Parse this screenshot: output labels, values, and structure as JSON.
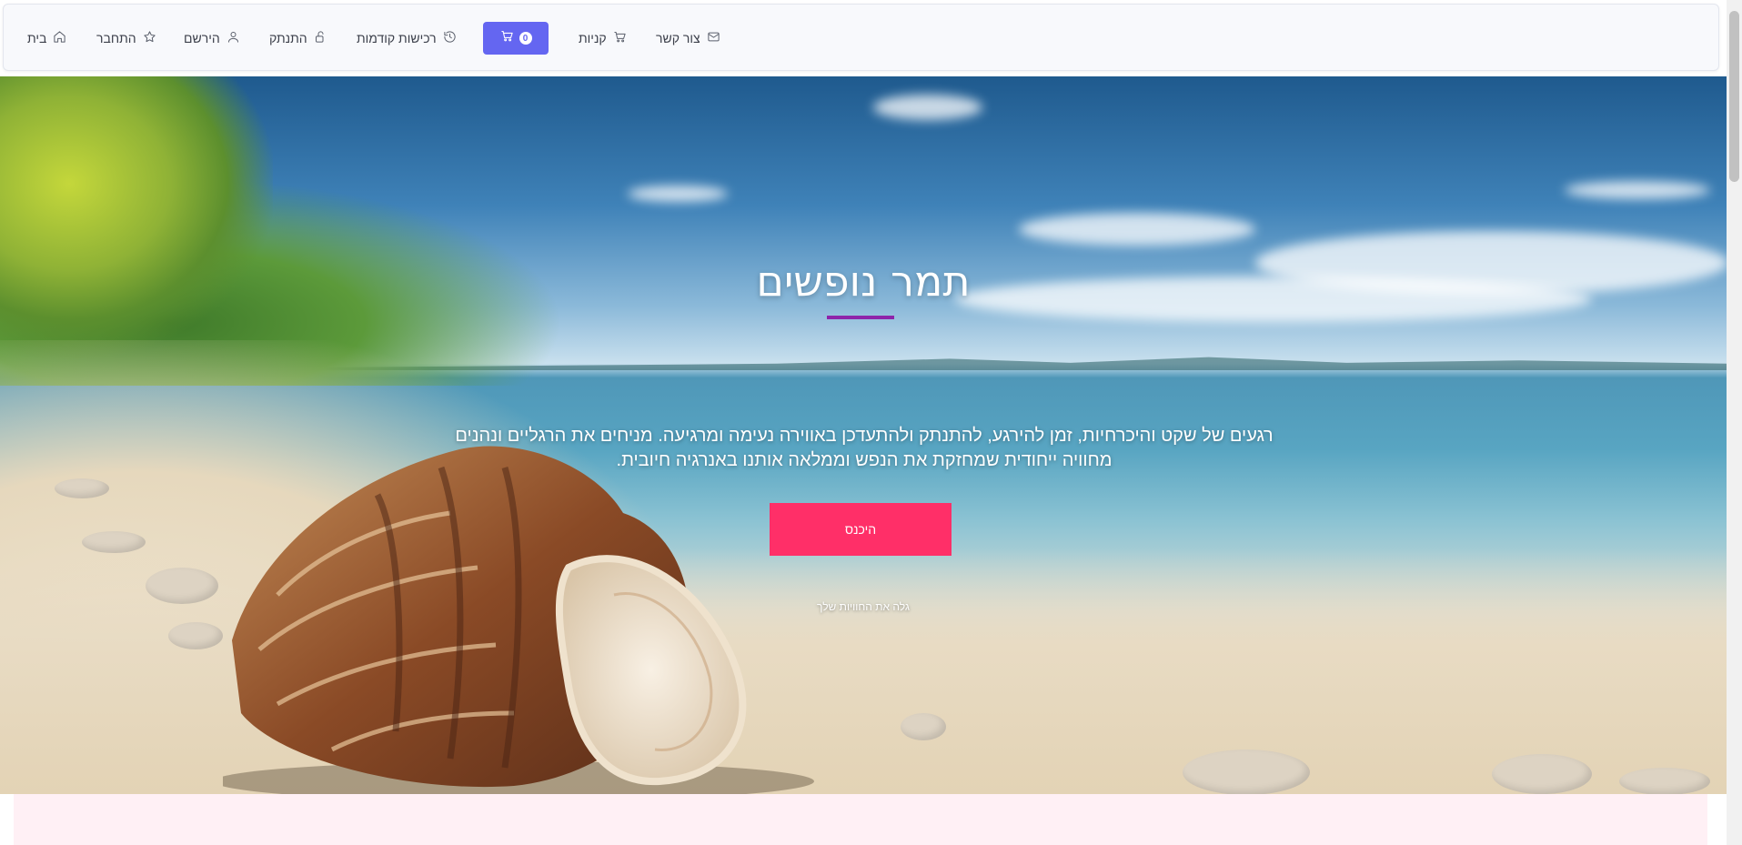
{
  "navbar": {
    "items": [
      {
        "label": "בית",
        "icon": "home-icon"
      },
      {
        "label": "התחבר",
        "icon": "star-icon"
      },
      {
        "label": "הירשם",
        "icon": "user-icon"
      },
      {
        "label": "התנתק",
        "icon": "unlock-icon"
      },
      {
        "label": "רכישות קודמות",
        "icon": "history-icon"
      },
      {
        "label": "קניות",
        "icon": "shopping-cart-icon"
      },
      {
        "label": "צור קשר",
        "icon": "mail-icon"
      }
    ],
    "cart": {
      "count": "0",
      "icon": "cart-icon",
      "color": "#6466f1"
    }
  },
  "hero": {
    "title": "תמר נופשים",
    "description": "רגעים של שקט והיכרחיות, זמן להירגע, להתנתק ולהתעדכן באווירה נעימה ומרגיעה. מניחים את הרגליים ונהנים מחוויה ייחודית שמחזקת את הנפש וממלאה אותנו באנרגיה חיובית.",
    "enter_button": "היכנס",
    "discover_text": "גלה את החוויות שלך",
    "accent_color": "#8e24aa",
    "button_color": "#ff2f68"
  }
}
